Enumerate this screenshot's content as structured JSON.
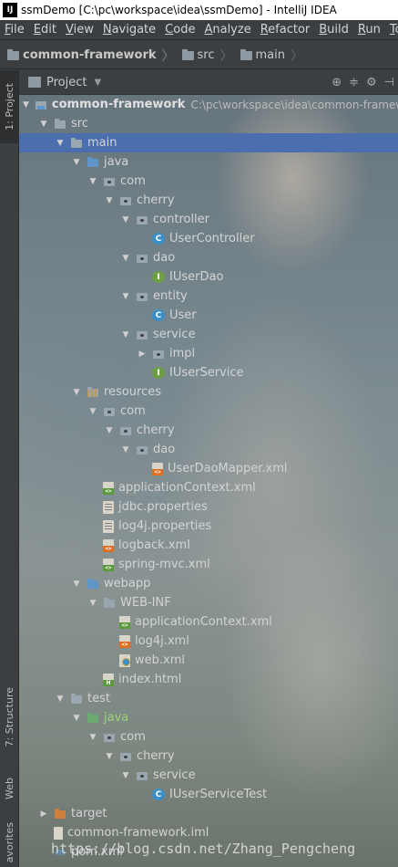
{
  "window": {
    "app_icon": "IJ",
    "title": "ssmDemo [C:\\pc\\workspace\\idea\\ssmDemo] - IntelliJ IDEA"
  },
  "menu": [
    "File",
    "Edit",
    "View",
    "Navigate",
    "Code",
    "Analyze",
    "Refactor",
    "Build",
    "Run",
    "Too"
  ],
  "breadcrumb": [
    "common-framework",
    "src",
    "main"
  ],
  "stripe": {
    "project_tab": "1: Project",
    "structure_tab": "7: Structure",
    "web_tab": "Web",
    "favorites_tab": "avorites"
  },
  "panel": {
    "title": "Project",
    "dropdown_icon": "triangle-down",
    "tools": [
      "target-icon",
      "collapse-icon",
      "gear-icon",
      "hide-icon"
    ]
  },
  "tree": [
    {
      "level": 0,
      "expanded": true,
      "icon": "module",
      "label": "common-framework",
      "bold": true,
      "path": "C:\\pc\\workspace\\idea\\common-framework"
    },
    {
      "level": 1,
      "expanded": true,
      "icon": "folder",
      "label": "src"
    },
    {
      "level": 2,
      "expanded": true,
      "icon": "folder",
      "label": "main",
      "selected": true
    },
    {
      "level": 3,
      "expanded": true,
      "icon": "folder-blue",
      "label": "java"
    },
    {
      "level": 4,
      "expanded": true,
      "icon": "package",
      "label": "com"
    },
    {
      "level": 5,
      "expanded": true,
      "icon": "package",
      "label": "cherry"
    },
    {
      "level": 6,
      "expanded": true,
      "icon": "package",
      "label": "controller"
    },
    {
      "level": 7,
      "icon": "class",
      "label": "UserController"
    },
    {
      "level": 6,
      "expanded": true,
      "icon": "package",
      "label": "dao"
    },
    {
      "level": 7,
      "icon": "interface",
      "label": "IUserDao"
    },
    {
      "level": 6,
      "expanded": true,
      "icon": "package",
      "label": "entity"
    },
    {
      "level": 7,
      "icon": "class",
      "label": "User"
    },
    {
      "level": 6,
      "expanded": true,
      "icon": "package",
      "label": "service"
    },
    {
      "level": 7,
      "expanded": false,
      "icon": "package",
      "label": "impl"
    },
    {
      "level": 7,
      "icon": "interface",
      "label": "IUserService"
    },
    {
      "level": 3,
      "expanded": true,
      "icon": "folder-res",
      "label": "resources"
    },
    {
      "level": 4,
      "expanded": true,
      "icon": "package",
      "label": "com"
    },
    {
      "level": 5,
      "expanded": true,
      "icon": "package",
      "label": "cherry"
    },
    {
      "level": 6,
      "expanded": true,
      "icon": "package",
      "label": "dao"
    },
    {
      "level": 7,
      "icon": "xml",
      "label": "UserDaoMapper.xml"
    },
    {
      "level": 4,
      "icon": "xml-green",
      "label": "applicationContext.xml"
    },
    {
      "level": 4,
      "icon": "props",
      "label": "jdbc.properties"
    },
    {
      "level": 4,
      "icon": "props",
      "label": "log4j.properties"
    },
    {
      "level": 4,
      "icon": "xml",
      "label": "logback.xml"
    },
    {
      "level": 4,
      "icon": "xml-green",
      "label": "spring-mvc.xml"
    },
    {
      "level": 3,
      "expanded": true,
      "icon": "folder-blue",
      "label": "webapp"
    },
    {
      "level": 4,
      "expanded": true,
      "icon": "folder",
      "label": "WEB-INF"
    },
    {
      "level": 5,
      "icon": "xml-green",
      "label": "applicationContext.xml"
    },
    {
      "level": 5,
      "icon": "xml",
      "label": "log4j.xml"
    },
    {
      "level": 5,
      "icon": "web",
      "label": "web.xml"
    },
    {
      "level": 4,
      "icon": "html",
      "label": "index.html"
    },
    {
      "level": 2,
      "expanded": true,
      "icon": "folder",
      "label": "test"
    },
    {
      "level": 3,
      "expanded": true,
      "icon": "folder-green",
      "label": "java",
      "green_text": true
    },
    {
      "level": 4,
      "expanded": true,
      "icon": "package",
      "label": "com"
    },
    {
      "level": 5,
      "expanded": true,
      "icon": "package",
      "label": "cherry"
    },
    {
      "level": 6,
      "expanded": true,
      "icon": "package",
      "label": "service"
    },
    {
      "level": 7,
      "icon": "class",
      "label": "IUserServiceTest"
    },
    {
      "level": 1,
      "expanded": false,
      "icon": "folder-orange",
      "label": "target"
    },
    {
      "level": 1,
      "icon": "iml",
      "label": "common-framework.iml"
    },
    {
      "level": 1,
      "icon": "maven",
      "label": "pom.xml"
    }
  ],
  "watermark": "https://blog.csdn.net/Zhang_Pengcheng",
  "colors": {
    "selection": "#4b6eaf",
    "background": "#3c3f41",
    "class_icon": "#3b8fc6",
    "interface_icon": "#6e9f45",
    "source_folder": "#5f95c8",
    "test_folder": "#6aab73",
    "excluded_folder": "#d07f3b"
  }
}
